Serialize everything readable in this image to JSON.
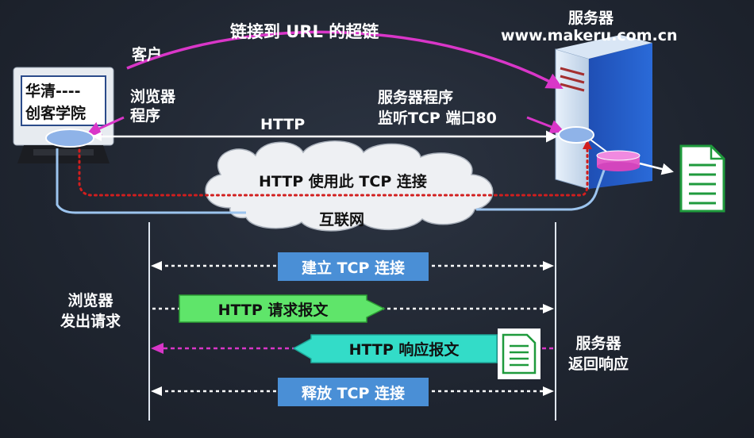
{
  "top_labels": {
    "hyperlink": "链接到 URL 的超链",
    "client": "客户",
    "server_title": "服务器",
    "server_url": "www.makeru.com.cn",
    "browser_program": "浏览器\n程序",
    "server_program_line1": "服务器程序",
    "server_program_line2": "监听TCP 端口80",
    "http": "HTTP",
    "cloud_conn": "HTTP 使用此 TCP 连接",
    "internet": "互联网"
  },
  "monitor_screen": {
    "line1": "华清----",
    "line2": "创客学院"
  },
  "sequence": {
    "left_label": "浏览器\n发出请求",
    "right_label": "服务器\n返回响应",
    "steps": [
      {
        "label": "建立 TCP 连接",
        "color": "#4a8fd6"
      },
      {
        "label": "HTTP 请求报文",
        "color": "#5fe56a"
      },
      {
        "label": "HTTP 响应报文",
        "color": "#33dcc8"
      },
      {
        "label": "释放 TCP 连接",
        "color": "#4a8fd6"
      }
    ]
  },
  "colors": {
    "magenta": "#d936c8",
    "red_dotted": "#d21e1e",
    "cloud": "#eef0f3",
    "doc_green": "#1f9a3c"
  }
}
